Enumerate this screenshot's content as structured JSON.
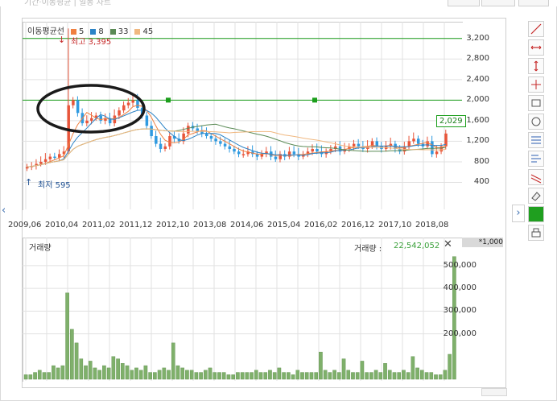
{
  "chart_data": {
    "type": "candlestick",
    "price_panel": {
      "legend_label": "이동평균선",
      "moving_averages": [
        {
          "name": "5",
          "color": "#f08040"
        },
        {
          "name": "8",
          "color": "#2b83c6"
        },
        {
          "name": "33",
          "color": "#5a8a55"
        },
        {
          "name": "45",
          "color": "#f0b880"
        }
      ],
      "y_ticks": [
        "3,200",
        "2,800",
        "2,400",
        "2,000",
        "1,600",
        "1,200",
        "800",
        "400"
      ],
      "x_ticks": [
        "2009,06",
        "2010,04",
        "2011,02",
        "2011,12",
        "2012,10",
        "2013,08",
        "2014,06",
        "2015,04",
        "2016,02",
        "2016,12",
        "2017,10",
        "2018,08"
      ],
      "high_label": "최고 3,395",
      "low_label": "최저 595",
      "horizontal_lines": [
        3200,
        2000
      ],
      "level_badge": "2,029",
      "ylim": [
        0,
        3400
      ],
      "close_series": [
        700,
        720,
        760,
        800,
        850,
        900,
        880,
        950,
        1000,
        1900,
        2000,
        1750,
        1550,
        1600,
        1650,
        1700,
        1600,
        1650,
        1550,
        1700,
        1800,
        1900,
        1950,
        2000,
        1850,
        1700,
        1500,
        1300,
        1150,
        1050,
        1100,
        1300,
        1250,
        1200,
        1350,
        1500,
        1450,
        1400,
        1350,
        1300,
        1250,
        1200,
        1150,
        1100,
        1050,
        1000,
        950,
        950,
        1000,
        950,
        900,
        950,
        1000,
        900,
        850,
        950,
        900,
        1000,
        950,
        900,
        950,
        1000,
        1050,
        1000,
        950,
        1000,
        1050,
        1100,
        1000,
        1050,
        1100,
        1150,
        1100,
        1050,
        1100,
        1200,
        1100,
        1050,
        1100,
        1150,
        1050,
        1000,
        1100,
        1200,
        1250,
        1150,
        1100,
        1200,
        950,
        1000,
        1100,
        1350
      ]
    },
    "volume_panel": {
      "title": "거래량",
      "readout_label": "거래량 :",
      "readout_value": "22,542,052",
      "multiplier": "*1,000",
      "y_ticks": [
        "500,000",
        "400,000",
        "300,000",
        "200,000"
      ],
      "ylim": [
        0,
        560000
      ],
      "values": [
        20000,
        20000,
        30000,
        40000,
        30000,
        30000,
        60000,
        50000,
        60000,
        380000,
        220000,
        160000,
        90000,
        60000,
        80000,
        50000,
        40000,
        60000,
        50000,
        100000,
        90000,
        70000,
        60000,
        40000,
        50000,
        40000,
        60000,
        30000,
        30000,
        40000,
        50000,
        40000,
        160000,
        60000,
        50000,
        40000,
        40000,
        30000,
        30000,
        40000,
        50000,
        30000,
        30000,
        30000,
        20000,
        20000,
        30000,
        30000,
        30000,
        30000,
        40000,
        30000,
        30000,
        40000,
        30000,
        50000,
        30000,
        30000,
        20000,
        40000,
        30000,
        30000,
        30000,
        30000,
        120000,
        40000,
        30000,
        40000,
        30000,
        90000,
        40000,
        30000,
        30000,
        80000,
        30000,
        30000,
        40000,
        30000,
        70000,
        40000,
        30000,
        30000,
        40000,
        30000,
        100000,
        50000,
        40000,
        30000,
        30000,
        20000,
        20000,
        40000,
        110000,
        540000
      ]
    }
  },
  "colors": {
    "candle_up": "#e8553a",
    "candle_down": "#2f9ae0",
    "grid": "#e1e1e1",
    "line_green": "#1b9e1b",
    "volume_bar": "#7fb06b",
    "highlight_ellipse": "#1a1a1a"
  },
  "toolbar": {
    "tools": [
      "trendline-icon",
      "horizontal-line-icon",
      "vertical-line-icon",
      "crosshair-icon",
      "rectangle-icon",
      "circle-icon",
      "fibonacci-icon",
      "gann-icon",
      "parallel-lines-icon",
      "eraser-icon",
      "color-picker-icon",
      "print-icon"
    ]
  },
  "header_ghost": "기간·이동평균  |  일봉 차트"
}
